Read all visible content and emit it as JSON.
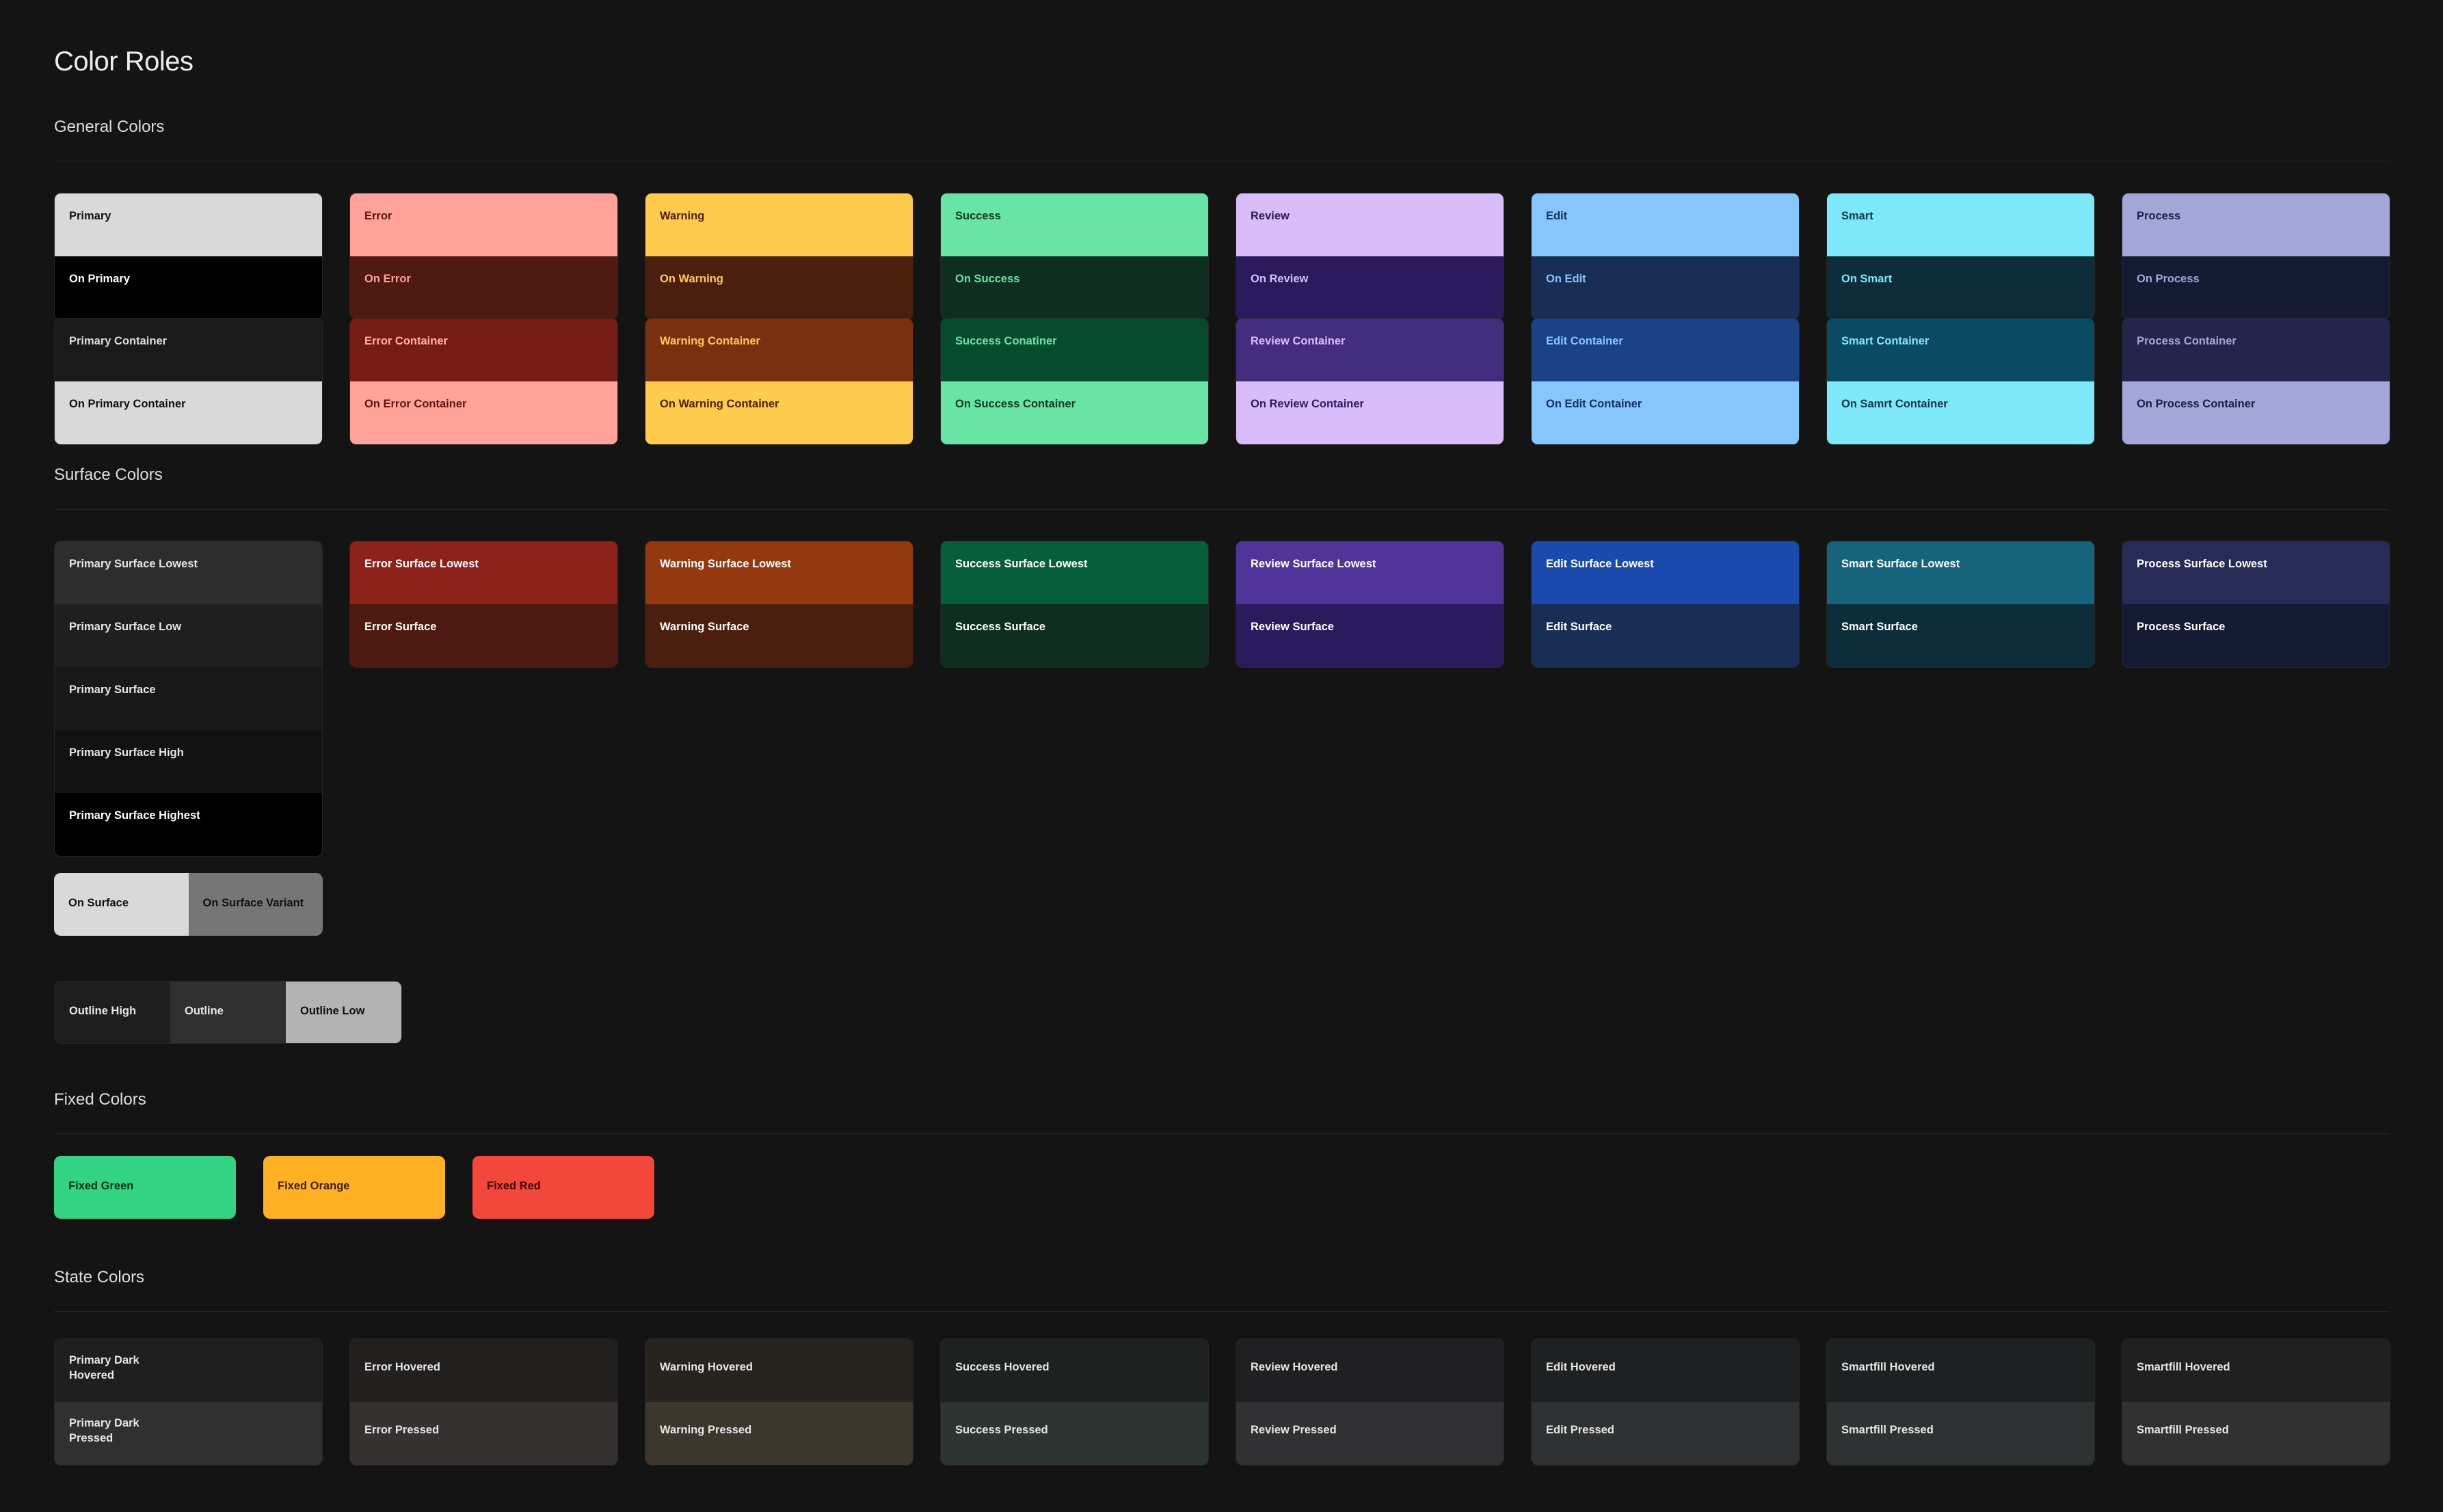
{
  "page_title": "Color Roles",
  "sections": {
    "general": "General Colors",
    "surface": "Surface Colors",
    "fixed": "Fixed Colors",
    "state": "State Colors"
  },
  "general_primary": [
    {
      "top": "Primary",
      "bottom": "On Primary",
      "top_bg": "#d9d9d9",
      "top_fg": "#111111",
      "bottom_bg": "#000000",
      "bottom_fg": "#ffffff"
    },
    {
      "top": "Error",
      "bottom": "On Error",
      "top_bg": "#ffa39a",
      "top_fg": "#5a1712",
      "bottom_bg": "#4e1a12",
      "bottom_fg": "#ffa39a"
    },
    {
      "top": "Warning",
      "bottom": "On Warning",
      "top_bg": "#ffcb4d",
      "top_fg": "#4f2106",
      "bottom_bg": "#4a1f0e",
      "bottom_fg": "#ffcb4d"
    },
    {
      "top": "Success",
      "bottom": "On Success",
      "top_bg": "#68e5a4",
      "top_fg": "#0c3b24",
      "bottom_bg": "#0e2e20",
      "bottom_fg": "#68e5a4"
    },
    {
      "top": "Review",
      "bottom": "On Review",
      "top_bg": "#d9bdfb",
      "top_fg": "#2d1a5d",
      "bottom_bg": "#2b1a5d",
      "bottom_fg": "#d9bdfb"
    },
    {
      "top": "Edit",
      "bottom": "On Edit",
      "top_bg": "#86c6fd",
      "top_fg": "#163063",
      "bottom_bg": "#182e55",
      "bottom_fg": "#86c6fd"
    },
    {
      "top": "Smart",
      "bottom": "On Smart",
      "top_bg": "#7ce8f9",
      "top_fg": "#0f3847",
      "bottom_bg": "#0d2d3a",
      "bottom_fg": "#7ce8f9"
    },
    {
      "top": "Process",
      "bottom": "On Process",
      "top_bg": "#a2a6d9",
      "top_fg": "#1b1f45",
      "bottom_bg": "#161b34",
      "bottom_fg": "#a2a6d9"
    }
  ],
  "general_container": [
    {
      "top": "Primary Container",
      "bottom": "On Primary Container",
      "top_bg": "#1a1a1a",
      "top_fg": "#dcdcdc",
      "bottom_bg": "#d9d9d9",
      "bottom_fg": "#111111"
    },
    {
      "top": "Error Container",
      "bottom": "On Error Container",
      "top_bg": "#771c14",
      "top_fg": "#ffb3ab",
      "bottom_bg": "#ffa39a",
      "bottom_fg": "#5a1712"
    },
    {
      "top": "Warning Container",
      "bottom": "On Warning Container",
      "top_bg": "#7a2f10",
      "top_fg": "#ffcb4d",
      "bottom_bg": "#ffcb4d",
      "bottom_fg": "#4f2106"
    },
    {
      "top": "Success Conatiner",
      "bottom": "On Success Container",
      "top_bg": "#064b2e",
      "top_fg": "#68e5a4",
      "bottom_bg": "#68e5a4",
      "bottom_fg": "#0c3b24"
    },
    {
      "top": "Review Container",
      "bottom": "On Review Container",
      "top_bg": "#432d7e",
      "top_fg": "#d9bdfb",
      "bottom_bg": "#d9bdfb",
      "bottom_fg": "#2d1a5d"
    },
    {
      "top": "Edit Container",
      "bottom": "On Edit Container",
      "top_bg": "#1b4187",
      "top_fg": "#86c6fd",
      "bottom_bg": "#86c6fd",
      "bottom_fg": "#163063"
    },
    {
      "top": "Smart Container",
      "bottom": "On Samrt Container",
      "top_bg": "#0b4a63",
      "top_fg": "#7ce8f9",
      "bottom_bg": "#7ce8f9",
      "bottom_fg": "#0f3847"
    },
    {
      "top": "Process Container",
      "bottom": "On Process Container",
      "top_bg": "#23264a",
      "top_fg": "#a2a6d9",
      "bottom_bg": "#a2a6d9",
      "bottom_fg": "#1b1f45"
    }
  ],
  "primary_surface_stack": [
    {
      "label": "Primary Surface Lowest",
      "bg": "#2d2d2d",
      "fg": "#e6e6e6"
    },
    {
      "label": "Primary Surface Low",
      "bg": "#1f1f1f",
      "fg": "#e6e6e6"
    },
    {
      "label": "Primary Surface",
      "bg": "#191919",
      "fg": "#e6e6e6"
    },
    {
      "label": "Primary Surface High",
      "bg": "#121212",
      "fg": "#e6e6e6"
    },
    {
      "label": "Primary Surface Highest",
      "bg": "#000000",
      "fg": "#ffffff"
    }
  ],
  "surface_cards": [
    {
      "top": "Error Surface Lowest",
      "bottom": "Error Surface",
      "top_bg": "#8c2219",
      "top_fg": "#ffffff",
      "bottom_bg": "#4e1a12",
      "bottom_fg": "#ffffff"
    },
    {
      "top": "Warning Surface Lowest",
      "bottom": "Warning Surface",
      "top_bg": "#93380f",
      "top_fg": "#ffffff",
      "bottom_bg": "#4a1f0e",
      "bottom_fg": "#ffffff"
    },
    {
      "top": "Success Surface Lowest",
      "bottom": "Success Surface",
      "top_bg": "#075e3a",
      "top_fg": "#ffffff",
      "bottom_bg": "#0e2e20",
      "bottom_fg": "#ffffff"
    },
    {
      "top": "Review Surface Lowest",
      "bottom": "Review Surface",
      "top_bg": "#4f359a",
      "top_fg": "#ffffff",
      "bottom_bg": "#2b1a5d",
      "bottom_fg": "#ffffff"
    },
    {
      "top": "Edit Surface Lowest",
      "bottom": "Edit Surface",
      "top_bg": "#1a4aad",
      "top_fg": "#ffffff",
      "bottom_bg": "#182e55",
      "bottom_fg": "#ffffff"
    },
    {
      "top": "Smart Surface Lowest",
      "bottom": "Smart Surface",
      "top_bg": "#15647b",
      "top_fg": "#ffffff",
      "bottom_bg": "#0d2d3a",
      "bottom_fg": "#ffffff"
    },
    {
      "top": "Process Surface Lowest",
      "bottom": "Process Surface",
      "top_bg": "#272c56",
      "top_fg": "#ffffff",
      "bottom_bg": "#161b34",
      "bottom_fg": "#ffffff"
    }
  ],
  "on_surface": {
    "on_surface": "On Surface",
    "on_surface_bg": "#d9d9d9",
    "on_surface_fg": "#111111",
    "on_surface_variant": "On Surface Variant",
    "on_surface_variant_bg": "#767676",
    "on_surface_variant_fg": "#111111"
  },
  "outlines": [
    {
      "label": "Outline High",
      "bg": "#1e1e1e",
      "fg": "#e6e6e6"
    },
    {
      "label": "Outline",
      "bg": "#2f2f2f",
      "fg": "#e6e6e6"
    },
    {
      "label": "Outline Low",
      "bg": "#b3b3b3",
      "fg": "#111111"
    }
  ],
  "fixed": [
    {
      "label": "Fixed Green",
      "bg": "#32d484",
      "fg": "#0b2a18"
    },
    {
      "label": "Fixed Orange",
      "bg": "#ffb123",
      "fg": "#3a1f05"
    },
    {
      "label": "Fixed Red",
      "bg": "#f4473b",
      "fg": "#3a0905"
    }
  ],
  "state_cards": [
    {
      "top": "Primary Dark\nHovered",
      "bottom": "Primary Dark\nPressed",
      "top_bg": "#1f1f1f",
      "bottom_bg": "#303030"
    },
    {
      "top": "Error Hovered",
      "bottom": "Error Pressed",
      "top_bg": "#221f1f",
      "bottom_bg": "#353131"
    },
    {
      "top": "Warning Hovered",
      "bottom": "Warning Pressed",
      "top_bg": "#27231f",
      "bottom_bg": "#3c362c"
    },
    {
      "top": "Success Hovered",
      "bottom": "Success Pressed",
      "top_bg": "#1d2220",
      "bottom_bg": "#2c3531"
    },
    {
      "top": "Review Hovered",
      "bottom": "Review Pressed",
      "top_bg": "#201f21",
      "bottom_bg": "#313133"
    },
    {
      "top": "Edit Hovered",
      "bottom": "Edit Pressed",
      "top_bg": "#1f2021",
      "bottom_bg": "#2f3133"
    },
    {
      "top": "Smartfill Hovered",
      "bottom": "Smartfill Pressed",
      "top_bg": "#1d2122",
      "bottom_bg": "#2f3232"
    },
    {
      "top": "Smartfill Hovered",
      "bottom": "Smartfill Pressed",
      "top_bg": "#202021",
      "bottom_bg": "#313131"
    }
  ],
  "state_fg": "#e6e6e6"
}
